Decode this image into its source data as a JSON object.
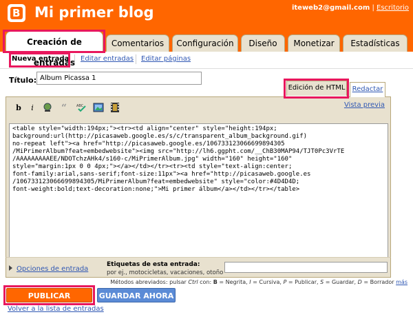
{
  "header": {
    "logo_letter": "B",
    "blog_title": "Mi primer blog",
    "user_email": "iteweb2@gmail.com",
    "separator": "|",
    "desk_link": "Escritorio"
  },
  "tabs": [
    {
      "label": "Creación de entradas"
    },
    {
      "label": "Comentarios"
    },
    {
      "label": "Configuración"
    },
    {
      "label": "Diseño"
    },
    {
      "label": "Monetizar"
    },
    {
      "label": "Estadísticas"
    }
  ],
  "subnav": {
    "new_post": "Nueva entrada",
    "edit_posts": "Editar entradas",
    "edit_pages": "Editar páginas"
  },
  "post": {
    "title_label": "Título:",
    "title_value": "Álbum Picassa 1"
  },
  "editor": {
    "mode_html": "Edición de HTML",
    "mode_compose": "Redactar",
    "preview": "Vista previa",
    "toolbar_icons": [
      "bold-icon",
      "italic-icon",
      "font-color-icon",
      "quote-icon",
      "spellcheck-icon",
      "image-icon",
      "video-icon"
    ],
    "toolbar_bold": "b",
    "toolbar_italic": "i",
    "code": "<table style=\"width:194px;\"><tr><td align=\"center\" style=\"height:194px;\nbackground:url(http://picasaweb.google.es/s/c/transparent_album_background.gif)\nno-repeat left\"><a href=\"http://picasaweb.google.es/106733123066699894305\n/MiPrimerAlbum?feat=embedwebsite\"><img src=\"http://lh6.ggpht.com/__ChB30MAP94/TJT0Pc3VrTE\n/AAAAAAAAAEE/NDOTchzAHk4/s160-c/MiPrimerAlbum.jpg\" width=\"160\" height=\"160\"\nstyle=\"margin:1px 0 0 4px;\"></a></td></tr><tr><td style=\"text-align:center;\nfont-family:arial,sans-serif;font-size:11px\"><a href=\"http://picasaweb.google.es\n/106733123066699894305/MiPrimerAlbum?feat=embedwebsite\" style=\"color:#4D4D4D;\nfont-weight:bold;text-decoration:none;\">Mi primer álbum</a></td></tr></table>"
  },
  "options": {
    "post_options": "Opciones de entrada",
    "labels_title": "Etiquetas de esta entrada:",
    "labels_hint": "por ej., motocicletas, vacaciones, otoño",
    "labels_value": ""
  },
  "shortcuts": {
    "text_prefix": "Métodos abreviados: pulsar ",
    "ctrl": "Ctrl",
    "text_body": " con: ",
    "b": "B",
    "b_desc": " = Negrita, ",
    "i": "I",
    "i_desc": " = Cursiva, ",
    "p": "P",
    "p_desc": " = Publicar, ",
    "s": "S",
    "s_desc": " = Guardar, ",
    "d": "D",
    "d_desc": " = Borrador ",
    "more": "más"
  },
  "buttons": {
    "publish": "PUBLICAR ENTRADA",
    "save": "GUARDAR AHORA",
    "back": "Volver a la lista de entradas"
  },
  "colors": {
    "brand_orange": "#ff6600",
    "highlight_pink": "#e8175d",
    "link_blue": "#2f57b3",
    "save_blue": "#5b8bd6"
  }
}
